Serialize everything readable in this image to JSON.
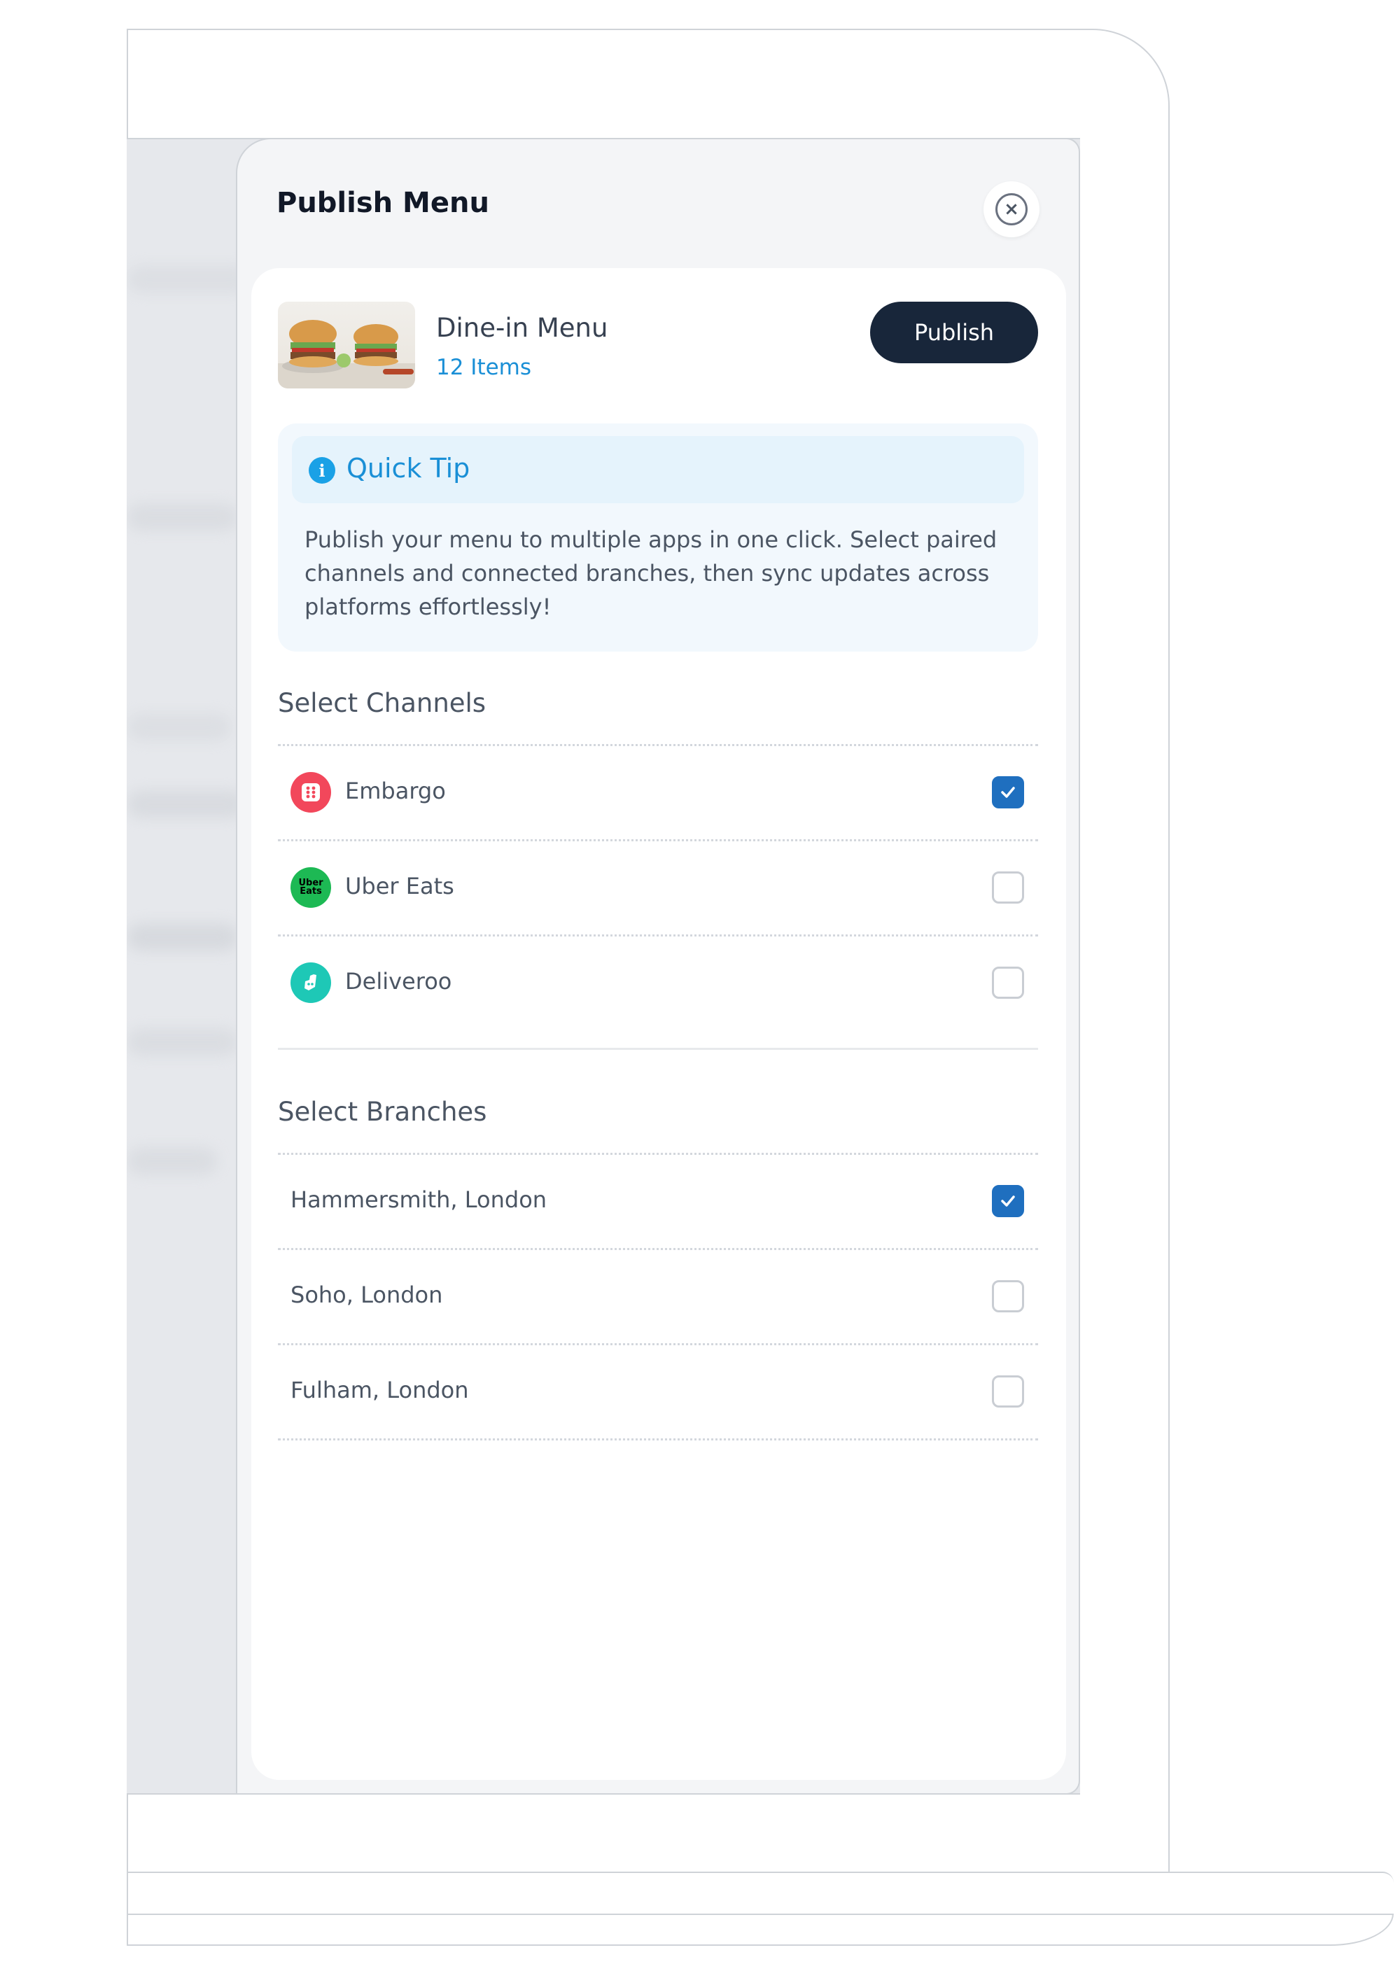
{
  "drawer": {
    "title": "Publish Menu",
    "close_icon": "close-circle-icon"
  },
  "menu": {
    "name": "Dine-in Menu",
    "items_count": "12 Items",
    "publish_label": "Publish",
    "thumbnail_icon": "burger-image"
  },
  "tip": {
    "title": "Quick Tip",
    "icon": "info-icon",
    "text": "Publish your menu to multiple apps in one click. Select paired channels and connected branches, then sync updates across platforms effortlessly!"
  },
  "channels": {
    "title": "Select Channels",
    "items": [
      {
        "label": "Embargo",
        "checked": true,
        "logo_color": "#f2475b",
        "logo_text": ""
      },
      {
        "label": "Uber Eats",
        "checked": false,
        "logo_color": "#1db954",
        "logo_text": "Uber Eats"
      },
      {
        "label": "Deliveroo",
        "checked": false,
        "logo_color": "#1ec8b6",
        "logo_text": ""
      }
    ]
  },
  "branches": {
    "title": "Select Branches",
    "items": [
      {
        "label": "Hammersmith, London",
        "checked": true
      },
      {
        "label": "Soho, London",
        "checked": false
      },
      {
        "label": "Fulham, London",
        "checked": false
      }
    ]
  },
  "colors": {
    "accent": "#1a8fd6",
    "publish_button": "#18263a",
    "checkbox_checked": "#1f6fbf"
  }
}
